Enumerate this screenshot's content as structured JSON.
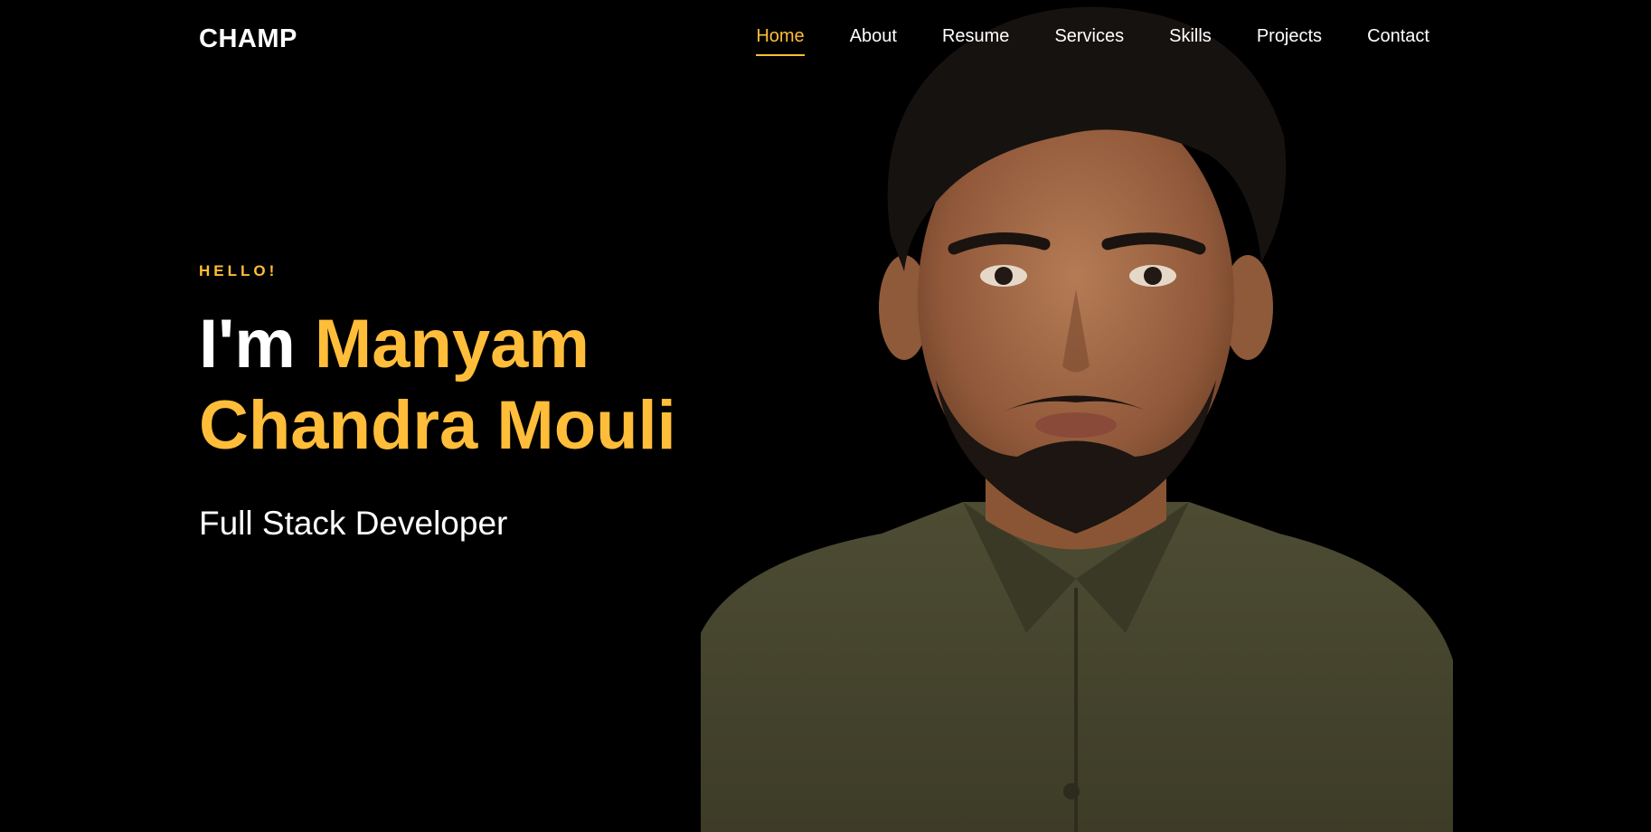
{
  "brand": {
    "logo_text": "CHAMP"
  },
  "nav": {
    "items": [
      {
        "label": "Home",
        "active": true
      },
      {
        "label": "About"
      },
      {
        "label": "Resume"
      },
      {
        "label": "Services"
      },
      {
        "label": "Skills"
      },
      {
        "label": "Projects"
      },
      {
        "label": "Contact"
      }
    ]
  },
  "hero": {
    "greeting": "HELLO!",
    "headline_prefix": "I'm ",
    "name_line1": "Manyam",
    "name_line2": "Chandra Mouli",
    "subtitle": "Full Stack Developer"
  },
  "colors": {
    "background": "#000000",
    "accent": "#ffbd39",
    "text": "#ffffff",
    "shirt": "#4a4a30"
  },
  "icons": {
    "portrait": "profile-photo"
  }
}
